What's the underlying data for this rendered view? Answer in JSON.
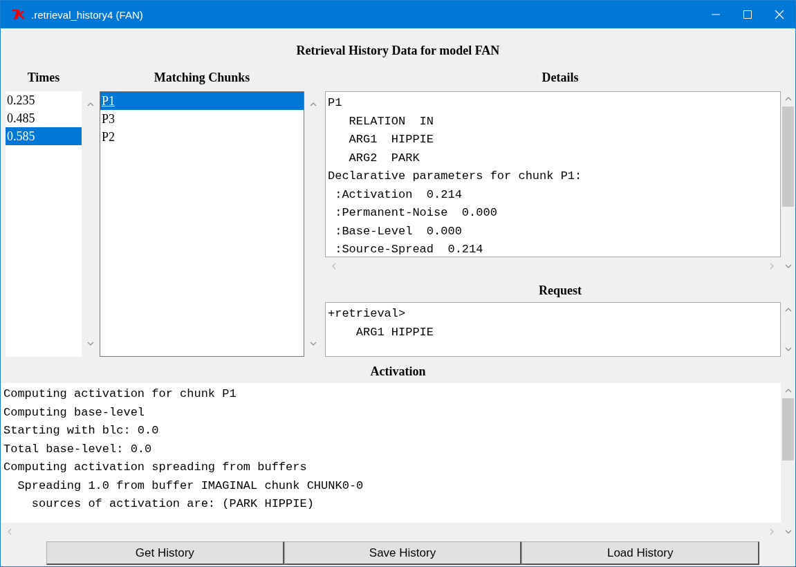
{
  "window": {
    "title": ".retrieval_history4 (FAN)"
  },
  "heading": "Retrieval History Data for model FAN",
  "times": {
    "label": "Times",
    "items": [
      {
        "text": "0.235",
        "selected": false
      },
      {
        "text": "0.485",
        "selected": false
      },
      {
        "text": "0.585",
        "selected": true
      }
    ]
  },
  "chunks": {
    "label": "Matching Chunks",
    "items": [
      {
        "text": "P1",
        "selected": true
      },
      {
        "text": "P3",
        "selected": false
      },
      {
        "text": "P2",
        "selected": false
      }
    ]
  },
  "details": {
    "label": "Details",
    "lines": [
      "P1",
      "   RELATION  IN",
      "   ARG1  HIPPIE",
      "   ARG2  PARK",
      "Declarative parameters for chunk P1:",
      " :Activation  0.214",
      " :Permanent-Noise  0.000",
      " :Base-Level  0.000",
      " :Source-Spread  0.214"
    ]
  },
  "request": {
    "label": "Request",
    "lines": [
      "+retrieval>",
      "    ARG1 HIPPIE"
    ]
  },
  "activation": {
    "label": "Activation",
    "lines": [
      "Computing activation for chunk P1",
      "Computing base-level",
      "Starting with blc: 0.0",
      "Total base-level: 0.0",
      "Computing activation spreading from buffers",
      "  Spreading 1.0 from buffer IMAGINAL chunk CHUNK0-0",
      "    sources of activation are: (PARK HIPPIE)"
    ]
  },
  "buttons": [
    "Get History",
    "Save History",
    "Load History"
  ]
}
